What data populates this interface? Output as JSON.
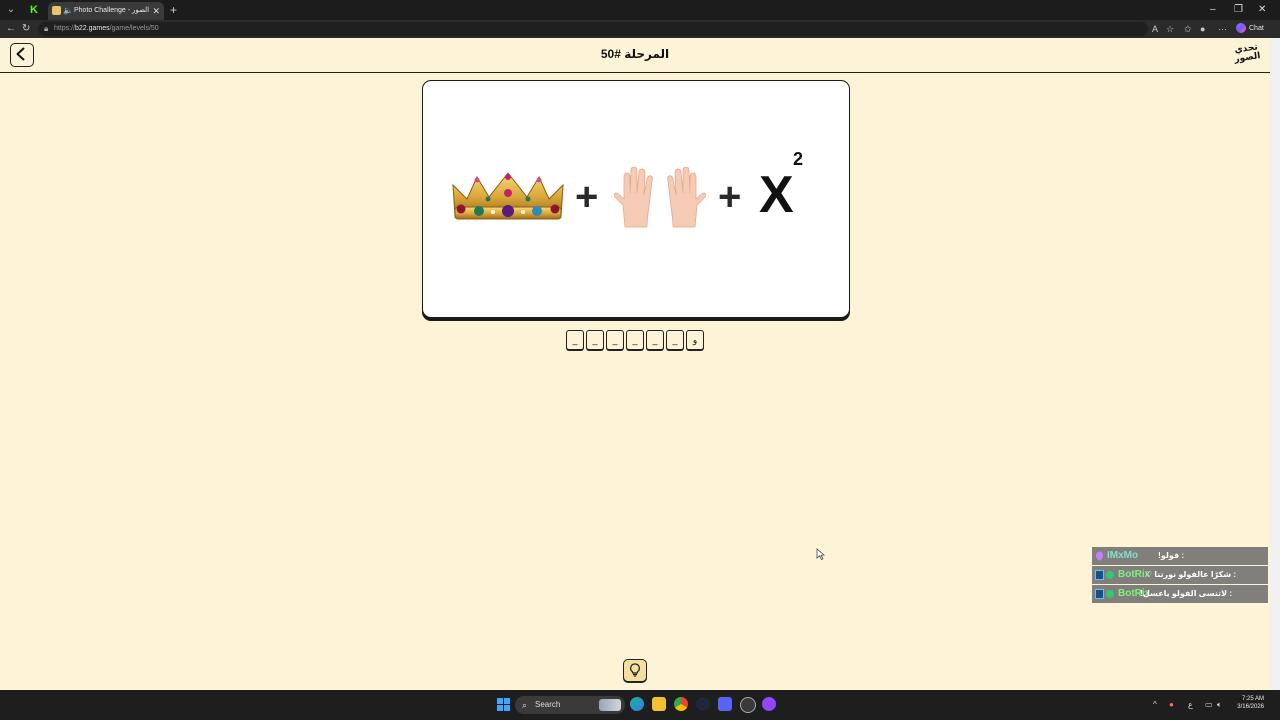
{
  "browser": {
    "tab_title": "Photo Challenge - تحدي الصور",
    "new_tab": "+",
    "url_prefix": "https://",
    "url_domain": "b22.games",
    "url_path": "/game/levels/50",
    "chat_label": "Chat"
  },
  "header": {
    "level_title": "المرحلة #50",
    "logo_text_top": "تحدي",
    "logo_text_bottom": "الصور"
  },
  "puzzle": {
    "items": [
      "crown",
      "plus",
      "two hands",
      "plus",
      "x squared"
    ],
    "plus": "+",
    "x_letter": "X",
    "exponent": "2"
  },
  "answer": {
    "slots": [
      "_",
      "_",
      "_",
      "_",
      "_",
      "_",
      "و"
    ]
  },
  "chat": {
    "lines": [
      {
        "user": "IMxMo",
        "message": ": فولو!",
        "user_color": "#7fe3c8"
      },
      {
        "user": "BotRix",
        "message": ": شكرًا عالفولو نورتنا ♡",
        "user_color": "#7ff07f"
      },
      {
        "user": "BotRix",
        "message": ": لاتنسى الفولو ياعسل!",
        "user_color": "#7ff07f"
      }
    ]
  },
  "taskbar": {
    "search_label": "Search",
    "time": "7:25 AM",
    "date": "3/16/2026",
    "lang": "ع"
  },
  "colors": {
    "page_bg": "#fdf4d7",
    "ink": "#111111",
    "hint_bg": "#f4dfa0"
  }
}
